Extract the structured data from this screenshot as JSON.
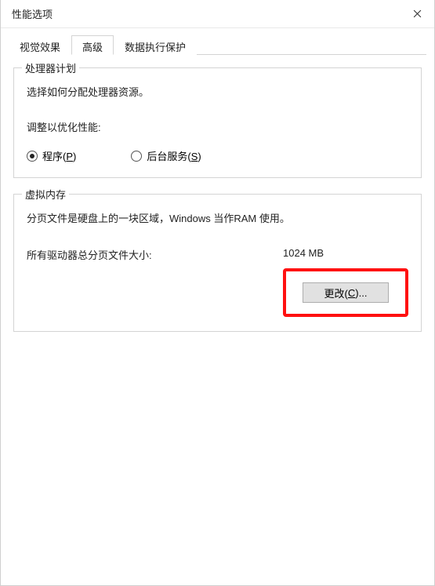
{
  "window": {
    "title": "性能选项"
  },
  "tabs": {
    "visual_effects": "视觉效果",
    "advanced": "高级",
    "dep": "数据执行保护"
  },
  "processor": {
    "legend": "处理器计划",
    "desc": "选择如何分配处理器资源。",
    "adjust_label": "调整以优化性能:",
    "opt_programs": "程序(",
    "opt_programs_key": "P",
    "opt_programs_suffix": ")",
    "opt_background": "后台服务(",
    "opt_background_key": "S",
    "opt_background_suffix": ")"
  },
  "virtual_memory": {
    "legend": "虚拟内存",
    "desc": "分页文件是硬盘上的一块区域，Windows 当作RAM 使用。",
    "total_label": "所有驱动器总分页文件大小:",
    "total_value": "1024 MB",
    "change_label_prefix": "更改(",
    "change_label_key": "C",
    "change_label_suffix": ")..."
  }
}
